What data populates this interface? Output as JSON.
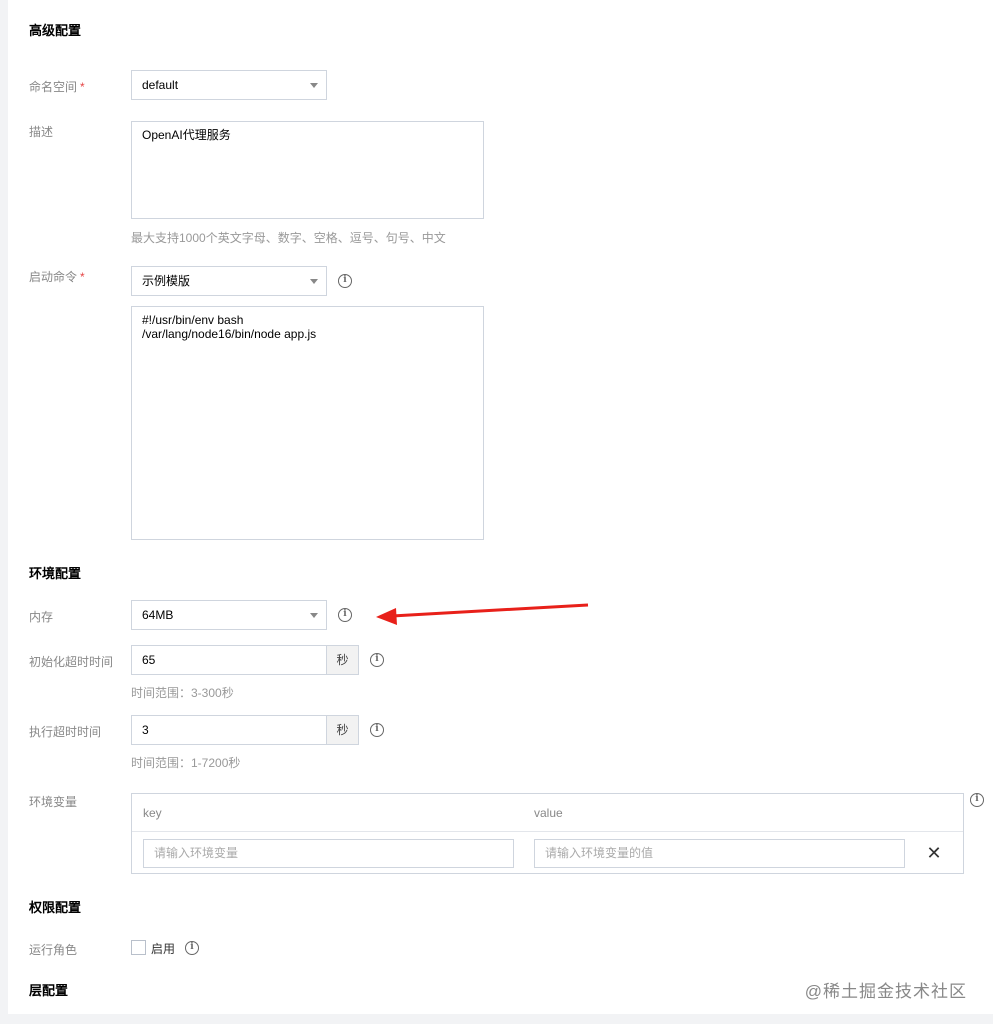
{
  "advanced": {
    "title": "高级配置",
    "namespace": {
      "label": "命名空间",
      "required_mark": "*",
      "value": "default"
    },
    "description": {
      "label": "描述",
      "value": "OpenAI代理服务",
      "hint": "最大支持1000个英文字母、数字、空格、逗号、句号、中文"
    },
    "start_command": {
      "label": "启动命令",
      "required_mark": "*",
      "template_value": "示例模版",
      "script": "#!/usr/bin/env bash\n/var/lang/node16/bin/node app.js"
    }
  },
  "environment": {
    "title": "环境配置",
    "memory": {
      "label": "内存",
      "value": "64MB"
    },
    "init_timeout": {
      "label": "初始化超时时间",
      "value": "65",
      "unit": "秒",
      "hint": "时间范围：3-300秒"
    },
    "exec_timeout": {
      "label": "执行超时时间",
      "value": "3",
      "unit": "秒",
      "hint": "时间范围：1-7200秒"
    },
    "env_vars": {
      "label": "环境变量",
      "key_header": "key",
      "value_header": "value",
      "key_placeholder": "请输入环境变量",
      "value_placeholder": "请输入环境变量的值"
    }
  },
  "permissions": {
    "title": "权限配置",
    "role": {
      "label": "运行角色",
      "checkbox_label": "启用"
    }
  },
  "layers": {
    "title": "层配置"
  },
  "watermark": "@稀土掘金技术社区",
  "icons": {
    "info": "info-circle-icon",
    "close": "close-icon",
    "caret": "chevron-down-icon",
    "annotation": "red-arrow-annotation"
  },
  "colors": {
    "required": "#e54545",
    "arrow": "#e8201a",
    "border": "#cfd5de",
    "label": "#888888"
  }
}
